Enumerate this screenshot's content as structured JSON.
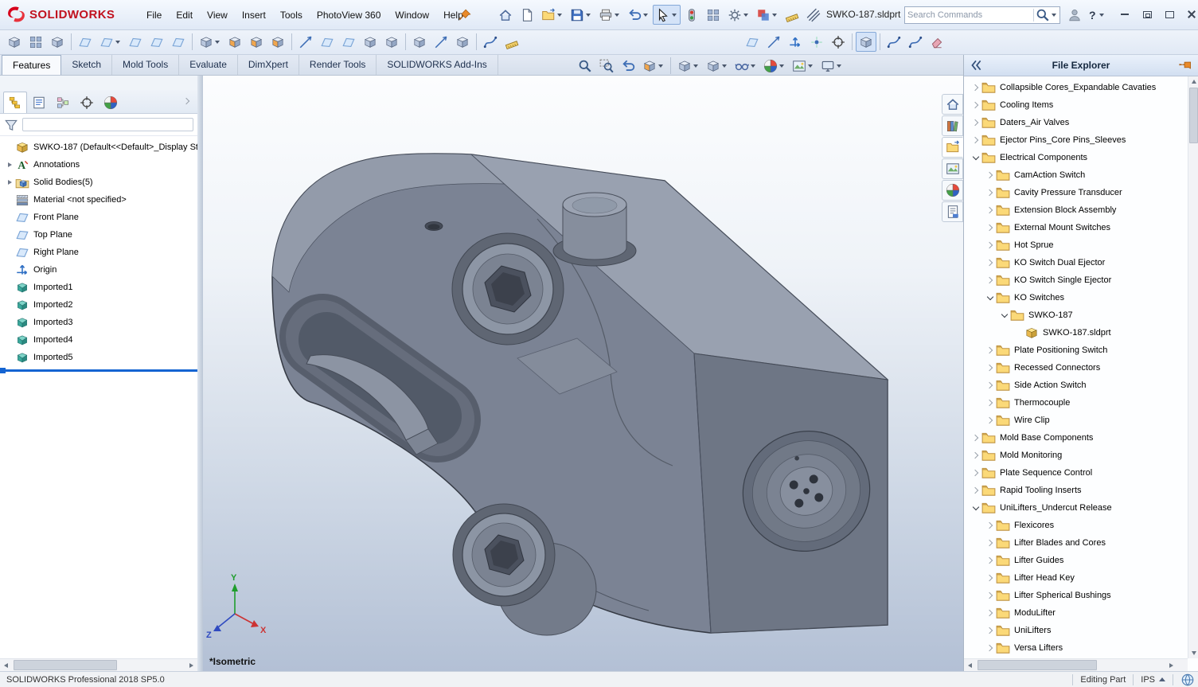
{
  "window": {
    "brand": "SOLIDWORKS",
    "menus": [
      "File",
      "Edit",
      "View",
      "Insert",
      "Tools",
      "PhotoView 360",
      "Window",
      "Help"
    ],
    "tools": [
      {
        "name": "home"
      },
      {
        "name": "new-document"
      },
      {
        "name": "open-document",
        "caret": true
      },
      {
        "name": "save",
        "caret": true
      },
      {
        "name": "print",
        "caret": true
      },
      {
        "name": "undo",
        "caret": true
      },
      {
        "name": "select",
        "caret": true,
        "active": true
      },
      {
        "name": "rebuild"
      },
      {
        "name": "window-layout"
      },
      {
        "name": "options",
        "caret": true
      },
      {
        "name": "edit-color",
        "caret": true
      },
      {
        "name": "measure"
      },
      {
        "name": "mass-properties"
      }
    ],
    "document": "SWKO-187.sldprt",
    "search_placeholder": "Search Commands",
    "help_label": "?"
  },
  "toolbar_tools": {
    "left": [
      {
        "name": "mounting-boss"
      },
      {
        "name": "vent"
      },
      {
        "name": "extrude-core"
      },
      {
        "name": "sep"
      },
      {
        "name": "planar-surface"
      },
      {
        "name": "offset-surface",
        "caret": true
      },
      {
        "name": "ruled-surface"
      },
      {
        "name": "knit-surface"
      },
      {
        "name": "filled-surface"
      },
      {
        "name": "sep"
      },
      {
        "name": "draft",
        "caret": true
      },
      {
        "name": "draft-analysis"
      },
      {
        "name": "undercut-analysis"
      },
      {
        "name": "parting-line-analysis"
      },
      {
        "name": "sep"
      },
      {
        "name": "parting-lines"
      },
      {
        "name": "shut-off-surfaces"
      },
      {
        "name": "parting-surfaces"
      },
      {
        "name": "tooling-split"
      },
      {
        "name": "core"
      },
      {
        "name": "sep"
      },
      {
        "name": "split"
      },
      {
        "name": "move-face"
      },
      {
        "name": "scale"
      },
      {
        "name": "sep"
      },
      {
        "name": "spline"
      },
      {
        "name": "measure"
      }
    ],
    "right": [
      {
        "name": "reference-plane"
      },
      {
        "name": "reference-axis"
      },
      {
        "name": "coordinate-system"
      },
      {
        "name": "reference-point"
      },
      {
        "name": "center-of-mass"
      },
      {
        "name": "sep"
      },
      {
        "name": "view-orientation",
        "active": true
      },
      {
        "name": "sep"
      },
      {
        "name": "curve-through-points"
      },
      {
        "name": "helix"
      },
      {
        "name": "eraser"
      }
    ]
  },
  "tabs": {
    "items": [
      "Features",
      "Sketch",
      "Mold Tools",
      "Evaluate",
      "DimXpert",
      "Render Tools",
      "SOLIDWORKS Add-Ins"
    ],
    "active": "Features"
  },
  "feature_panel": {
    "tabs": [
      "featuremanager",
      "propertymanager",
      "configurationmanager",
      "dimxpertmanager",
      "displaymanager"
    ],
    "active_tab": "featuremanager",
    "root_label": "SWKO-187  (Default<<Default>_Display St",
    "items": [
      {
        "label": "Annotations",
        "icon": "annotations",
        "chevron": true
      },
      {
        "label": "Solid Bodies(5)",
        "icon": "solid-bodies",
        "chevron": true
      },
      {
        "label": "Material <not specified>",
        "icon": "material"
      },
      {
        "label": "Front Plane",
        "icon": "plane"
      },
      {
        "label": "Top Plane",
        "icon": "plane"
      },
      {
        "label": "Right Plane",
        "icon": "plane"
      },
      {
        "label": "Origin",
        "icon": "origin"
      },
      {
        "label": "Imported1",
        "icon": "imported"
      },
      {
        "label": "Imported2",
        "icon": "imported"
      },
      {
        "label": "Imported3",
        "icon": "imported"
      },
      {
        "label": "Imported4",
        "icon": "imported"
      },
      {
        "label": "Imported5",
        "icon": "imported"
      }
    ]
  },
  "headsup": [
    {
      "name": "zoom-fit"
    },
    {
      "name": "zoom-area"
    },
    {
      "name": "previous-view"
    },
    {
      "name": "section-view",
      "caret": true
    },
    {
      "name": "sep"
    },
    {
      "name": "view-orientation",
      "caret": true
    },
    {
      "name": "display-style",
      "caret": true
    },
    {
      "name": "hide-show-items",
      "caret": true
    },
    {
      "name": "edit-appearance",
      "caret": true
    },
    {
      "name": "apply-scene",
      "caret": true
    },
    {
      "name": "view-settings",
      "caret": true
    }
  ],
  "viewport": {
    "view_label": "*Isometric",
    "triad": {
      "x": "X",
      "y": "Y",
      "z": "Z"
    }
  },
  "task_pane": {
    "title": "File Explorer",
    "strip": [
      "solidworks-resources",
      "design-library",
      "file-explorer",
      "view-palette",
      "appearances",
      "custom-properties"
    ],
    "active_tab": "file-explorer",
    "tree": [
      {
        "label": "Collapsible Cores_Expandable Cavaties",
        "depth": 0,
        "chevron": "right",
        "icon": "folder"
      },
      {
        "label": "Cooling Items",
        "depth": 0,
        "chevron": "right",
        "icon": "folder"
      },
      {
        "label": "Daters_Air Valves",
        "depth": 0,
        "chevron": "right",
        "icon": "folder"
      },
      {
        "label": "Ejector Pins_Core Pins_Sleeves",
        "depth": 0,
        "chevron": "right",
        "icon": "folder"
      },
      {
        "label": "Electrical Components",
        "depth": 0,
        "chevron": "down",
        "icon": "folder"
      },
      {
        "label": "CamAction Switch",
        "depth": 1,
        "chevron": "right",
        "icon": "folder"
      },
      {
        "label": "Cavity Pressure Transducer",
        "depth": 1,
        "chevron": "right",
        "icon": "folder"
      },
      {
        "label": "Extension Block Assembly",
        "depth": 1,
        "chevron": "right",
        "icon": "folder"
      },
      {
        "label": "External Mount Switches",
        "depth": 1,
        "chevron": "right",
        "icon": "folder"
      },
      {
        "label": "Hot Sprue",
        "depth": 1,
        "chevron": "right",
        "icon": "folder"
      },
      {
        "label": "KO Switch Dual Ejector",
        "depth": 1,
        "chevron": "right",
        "icon": "folder"
      },
      {
        "label": "KO Switch Single Ejector",
        "depth": 1,
        "chevron": "right",
        "icon": "folder"
      },
      {
        "label": "KO Switches",
        "depth": 1,
        "chevron": "down",
        "icon": "folder"
      },
      {
        "label": "SWKO-187",
        "depth": 2,
        "chevron": "down",
        "icon": "folder"
      },
      {
        "label": "SWKO-187.sldprt",
        "depth": 3,
        "chevron": "none",
        "icon": "part"
      },
      {
        "label": "Plate Positioning Switch",
        "depth": 1,
        "chevron": "right",
        "icon": "folder"
      },
      {
        "label": "Recessed Connectors",
        "depth": 1,
        "chevron": "right",
        "icon": "folder"
      },
      {
        "label": "Side Action Switch",
        "depth": 1,
        "chevron": "right",
        "icon": "folder"
      },
      {
        "label": "Thermocouple",
        "depth": 1,
        "chevron": "right",
        "icon": "folder"
      },
      {
        "label": "Wire Clip",
        "depth": 1,
        "chevron": "right",
        "icon": "folder"
      },
      {
        "label": "Mold Base Components",
        "depth": 0,
        "chevron": "right",
        "icon": "folder"
      },
      {
        "label": "Mold Monitoring",
        "depth": 0,
        "chevron": "right",
        "icon": "folder"
      },
      {
        "label": "Plate Sequence Control",
        "depth": 0,
        "chevron": "right",
        "icon": "folder"
      },
      {
        "label": "Rapid Tooling Inserts",
        "depth": 0,
        "chevron": "right",
        "icon": "folder"
      },
      {
        "label": "UniLifters_Undercut Release",
        "depth": 0,
        "chevron": "down",
        "icon": "folder"
      },
      {
        "label": "Flexicores",
        "depth": 1,
        "chevron": "right",
        "icon": "folder"
      },
      {
        "label": "Lifter Blades and Cores",
        "depth": 1,
        "chevron": "right",
        "icon": "folder"
      },
      {
        "label": "Lifter Guides",
        "depth": 1,
        "chevron": "right",
        "icon": "folder"
      },
      {
        "label": "Lifter Head Key",
        "depth": 1,
        "chevron": "right",
        "icon": "folder"
      },
      {
        "label": "Lifter Spherical Bushings",
        "depth": 1,
        "chevron": "right",
        "icon": "folder"
      },
      {
        "label": "ModuLifter",
        "depth": 1,
        "chevron": "right",
        "icon": "folder"
      },
      {
        "label": "UniLifters",
        "depth": 1,
        "chevron": "right",
        "icon": "folder"
      },
      {
        "label": "Versa Lifters",
        "depth": 1,
        "chevron": "right",
        "icon": "folder"
      }
    ]
  },
  "statusbar": {
    "left": "SOLIDWORKS Professional 2018 SP5.0",
    "mode": "Editing Part",
    "units": "IPS"
  }
}
